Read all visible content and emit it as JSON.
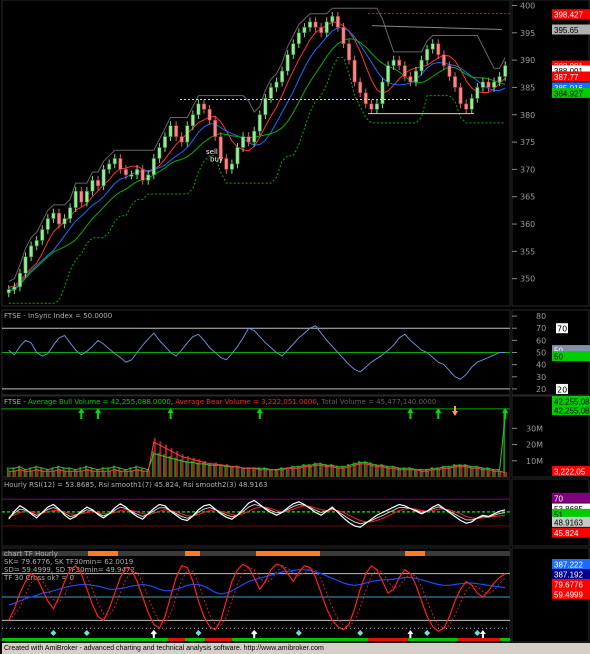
{
  "app": {
    "footer": "Created with AmiBroker - advanced charting and technical analysis software. http://www.amibroker.com"
  },
  "colors": {
    "background": "#000000",
    "up_candle": "#7fd87f",
    "down_candle": "#e06060",
    "accent_green": "#00cc00",
    "accent_red": "#ff0000",
    "accent_blue": "#1a6bff"
  },
  "chart_data": [
    {
      "type": "candlestick",
      "panel": "price",
      "ylim": [
        345,
        401
      ],
      "y_ticks": [
        "350",
        "355",
        "360",
        "365",
        "370",
        "375",
        "380",
        "385",
        "390",
        "395",
        "400"
      ],
      "price_labels": [
        {
          "text": "398.427",
          "value": 398.4,
          "color": "#ff0000"
        },
        {
          "text": "395.65",
          "value": 395.6,
          "color": "#b0b0b0"
        },
        {
          "text": "388.981",
          "value": 389.0,
          "color": "#ff0000"
        },
        {
          "text": "388.091",
          "value": 388.1,
          "color": "#ffffff"
        },
        {
          "text": "387.77",
          "value": 387.0,
          "color": "#ff0000"
        },
        {
          "text": "385.016",
          "value": 385.0,
          "color": "#1a6bff"
        },
        {
          "text": "384.927",
          "value": 384.0,
          "color": "#00cc00"
        }
      ],
      "annotations": [
        "sell",
        "buy"
      ],
      "closes": [
        348,
        348.5,
        351,
        354,
        356,
        357,
        359,
        361,
        362,
        360,
        361,
        363,
        366,
        364,
        366,
        368,
        367,
        370,
        371,
        372,
        370,
        369,
        369,
        370,
        368,
        369,
        372,
        374,
        376,
        378,
        376,
        375,
        378,
        380,
        382,
        381,
        379,
        376,
        372,
        370,
        371,
        374,
        376,
        375,
        377,
        380,
        383,
        385,
        386,
        388,
        391,
        393,
        395,
        396,
        397,
        396,
        395,
        397,
        398,
        396,
        393,
        390,
        386,
        384,
        382,
        381,
        382,
        386,
        389,
        390,
        389,
        387,
        386,
        388,
        390,
        392,
        393,
        391,
        389,
        387,
        385,
        382,
        381,
        383,
        385,
        386,
        385,
        386,
        387,
        389
      ]
    },
    {
      "type": "line",
      "panel": "insync",
      "title": "FTSE - InSync Index = 50.0000",
      "ylim": [
        15,
        85
      ],
      "y_ticks": [
        "80",
        "70",
        "60",
        "50",
        "40",
        "30",
        "20"
      ],
      "levels": [
        {
          "value": 70,
          "label": "70"
        },
        {
          "value": 50,
          "label": "50"
        },
        {
          "value": 20,
          "label": "20"
        }
      ],
      "badge_labels": [
        "50",
        "50"
      ],
      "values": [
        52,
        48,
        55,
        60,
        58,
        50,
        47,
        49,
        56,
        62,
        64,
        58,
        52,
        48,
        51,
        55,
        60,
        57,
        53,
        49,
        46,
        42,
        44,
        50,
        56,
        61,
        66,
        60,
        55,
        50,
        47,
        52,
        58,
        63,
        65,
        60,
        54,
        50,
        46,
        44,
        49,
        55,
        62,
        70,
        68,
        63,
        58,
        54,
        50,
        47,
        52,
        57,
        62,
        66,
        70,
        72,
        66,
        60,
        55,
        50,
        45,
        40,
        36,
        34,
        38,
        42,
        45,
        48,
        52,
        56,
        62,
        65,
        60,
        56,
        52,
        50,
        46,
        42,
        40,
        35,
        30,
        28,
        32,
        38,
        42,
        44,
        46,
        48,
        50,
        50
      ]
    },
    {
      "type": "bar",
      "panel": "volume",
      "title_parts": [
        {
          "text": "FTSE - ",
          "color": "#b0b0b0"
        },
        {
          "text": "Average Bull Volume = 42,255,088.0000",
          "color": "#00cc00"
        },
        {
          "text": ", ",
          "color": "#b0b0b0"
        },
        {
          "text": "Average Bear Volume = 3,222,051.0000",
          "color": "#ff2020"
        },
        {
          "text": ", ",
          "color": "#b0b0b0"
        },
        {
          "text": "Total Volume = 45,477,140.0000",
          "color": "#606060"
        }
      ],
      "ylim": [
        0,
        45
      ],
      "y_ticks": [
        "30M",
        "20M",
        "10M"
      ],
      "badge_labels": [
        {
          "text": "42,255,08",
          "color": "#00cc00"
        },
        {
          "text": "42,255,08",
          "color": "#00cc00"
        },
        {
          "text": "3,222,05",
          "color": "#ff0000"
        }
      ],
      "bull_volume": [
        6,
        6,
        7,
        5,
        6,
        7,
        6,
        5,
        6,
        7,
        6,
        6,
        5,
        6,
        7,
        6,
        5,
        6,
        6,
        7,
        6,
        5,
        6,
        7,
        6,
        5,
        16,
        15,
        14,
        13,
        12,
        11,
        10,
        10,
        9,
        9,
        8,
        8,
        8,
        7,
        7,
        7,
        6,
        6,
        6,
        6,
        6,
        5,
        5,
        6,
        6,
        7,
        7,
        8,
        8,
        9,
        9,
        8,
        8,
        7,
        7,
        8,
        9,
        10,
        10,
        9,
        8,
        8,
        7,
        7,
        6,
        6,
        6,
        5,
        5,
        5,
        6,
        6,
        7,
        7,
        8,
        8,
        8,
        7,
        7,
        6,
        6,
        5,
        5,
        42
      ],
      "bear_volume": [
        4,
        4,
        5,
        4,
        4,
        5,
        4,
        4,
        4,
        5,
        4,
        4,
        4,
        4,
        5,
        4,
        4,
        4,
        4,
        5,
        4,
        4,
        4,
        5,
        4,
        4,
        24,
        22,
        20,
        18,
        16,
        14,
        13,
        12,
        11,
        10,
        9,
        9,
        8,
        8,
        7,
        7,
        6,
        6,
        6,
        5,
        5,
        5,
        5,
        5,
        6,
        6,
        6,
        7,
        7,
        8,
        8,
        7,
        7,
        6,
        6,
        7,
        8,
        9,
        9,
        8,
        7,
        7,
        6,
        6,
        5,
        5,
        5,
        5,
        4,
        4,
        5,
        5,
        6,
        6,
        7,
        7,
        7,
        6,
        6,
        5,
        5,
        4,
        4,
        3
      ]
    },
    {
      "type": "line",
      "panel": "rsi",
      "title": "Hourly RSI(12) = 53.8685, Rsi smooth1(7) 45.824, Rsi smooth2(3) 48.9163",
      "ylim": [
        0,
        100
      ],
      "badge_labels": [
        {
          "text": "70",
          "color": "#800080"
        },
        {
          "text": "53.8685",
          "color": "#ffffff"
        },
        {
          "text": "51",
          "color": "#00cc00"
        },
        {
          "text": "48.9163",
          "color": "#c8c8c8"
        },
        {
          "text": "45.824",
          "color": "#ff0000"
        }
      ],
      "rsi": [
        40,
        52,
        60,
        55,
        48,
        42,
        50,
        58,
        62,
        55,
        46,
        40,
        44,
        52,
        58,
        54,
        47,
        42,
        48,
        57,
        63,
        58,
        50,
        44,
        40,
        48,
        56,
        62,
        60,
        52,
        46,
        40,
        38,
        45,
        54,
        60,
        62,
        55,
        48,
        43,
        40,
        46,
        55,
        64,
        68,
        62,
        55,
        50,
        46,
        50,
        57,
        63,
        66,
        62,
        56,
        50,
        46,
        52,
        58,
        50,
        42,
        35,
        30,
        28,
        34,
        40,
        46,
        50,
        54,
        58,
        62,
        60,
        56,
        52,
        48,
        52,
        58,
        62,
        56,
        50,
        44,
        38,
        34,
        36,
        42,
        46,
        44,
        48,
        52,
        54
      ],
      "smooth1": [
        44,
        46,
        50,
        52,
        51,
        49,
        49,
        51,
        53,
        53,
        51,
        48,
        47,
        48,
        50,
        51,
        50,
        48,
        48,
        50,
        53,
        54,
        53,
        51,
        48,
        47,
        49,
        52,
        54,
        53,
        51,
        48,
        45,
        45,
        47,
        50,
        53,
        54,
        52,
        50,
        47,
        46,
        48,
        52,
        56,
        58,
        58,
        56,
        53,
        51,
        52,
        55,
        58,
        60,
        59,
        57,
        54,
        53,
        54,
        53,
        50,
        46,
        42,
        38,
        36,
        36,
        38,
        41,
        45,
        49,
        53,
        55,
        56,
        55,
        53,
        52,
        53,
        55,
        55,
        54,
        51,
        48,
        44,
        42,
        41,
        42,
        43,
        44,
        45,
        45.8
      ]
    },
    {
      "type": "line",
      "panel": "stoch",
      "title_lines": [
        {
          "text": "chart TF  Hourly",
          "color": "#b0b0b0"
        },
        {
          "text": "SK= 79.6776,  SK TF30min= 62.0019",
          "color": "#b0b0b0"
        },
        {
          "text": "SD= 59.4999,  SD TF30min= 49.9472",
          "color": "#b0b0b0"
        },
        {
          "text": "TF 30 Cross ok? = 0",
          "color": "#b0b0b0"
        }
      ],
      "ylim": [
        0,
        100
      ],
      "badge_labels": [
        {
          "text": "387.222",
          "color": "#1a6bff"
        },
        {
          "text": "387.192",
          "color": "#00008b"
        },
        {
          "text": "79.6776",
          "color": "#ff0000"
        },
        {
          "text": "59.4999",
          "color": "#ff0000"
        }
      ],
      "sk": [
        20,
        35,
        55,
        70,
        80,
        75,
        60,
        45,
        35,
        50,
        70,
        85,
        90,
        80,
        60,
        40,
        25,
        20,
        35,
        55,
        75,
        88,
        85,
        70,
        50,
        30,
        15,
        10,
        25,
        50,
        75,
        90,
        88,
        70,
        45,
        25,
        12,
        8,
        20,
        45,
        70,
        85,
        92,
        88,
        75,
        60,
        70,
        85,
        92,
        90,
        80,
        70,
        82,
        90,
        88,
        75,
        55,
        35,
        20,
        12,
        8,
        15,
        35,
        60,
        80,
        90,
        85,
        70,
        55,
        60,
        75,
        85,
        80,
        65,
        45,
        25,
        12,
        6,
        10,
        25,
        45,
        60,
        70,
        65,
        55,
        50,
        58,
        68,
        75,
        80
      ],
      "tf30": [
        40,
        42,
        45,
        48,
        50,
        52,
        55,
        56,
        58,
        60,
        62,
        64,
        65,
        66,
        66,
        65,
        64,
        62,
        60,
        60,
        61,
        62,
        64,
        65,
        66,
        65,
        63,
        60,
        58,
        58,
        60,
        62,
        65,
        66,
        66,
        64,
        60,
        56,
        54,
        55,
        58,
        62,
        66,
        70,
        72,
        74,
        76,
        78,
        80,
        82,
        83,
        84,
        85,
        85,
        84,
        82,
        80,
        77,
        74,
        71,
        68,
        66,
        65,
        66,
        68,
        70,
        71,
        72,
        72,
        73,
        74,
        75,
        75,
        74,
        72,
        70,
        68,
        66,
        65,
        65,
        66,
        67,
        68,
        68,
        67,
        66,
        65,
        64,
        63,
        62
      ]
    }
  ]
}
